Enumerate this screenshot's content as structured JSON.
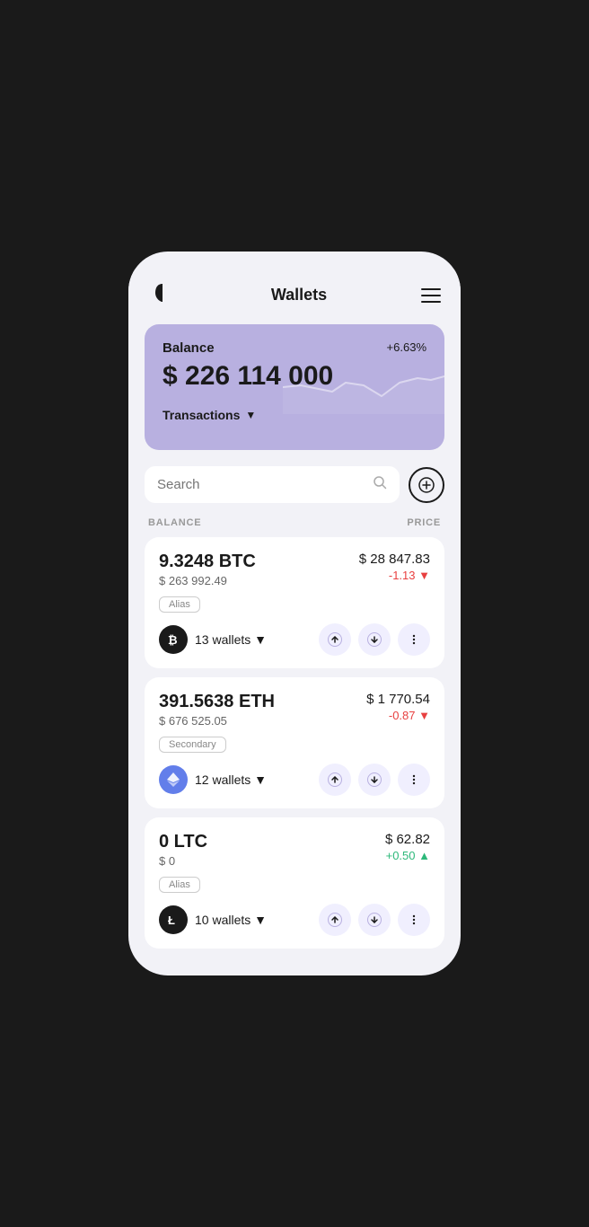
{
  "header": {
    "title": "Wallets",
    "menu_label": "menu"
  },
  "balance_card": {
    "label": "Balance",
    "percentage": "+6.63%",
    "amount": "$ 226 114 000",
    "transactions_label": "Transactions"
  },
  "search": {
    "placeholder": "Search"
  },
  "columns": {
    "balance": "BALANCE",
    "price": "PRICE"
  },
  "coins": [
    {
      "amount": "9.3248 BTC",
      "usd": "$ 263 992.49",
      "price": "$ 28 847.83",
      "change": "-1.13",
      "change_type": "neg",
      "alias": "Alias",
      "wallets": "13 wallets",
      "logo_type": "btc"
    },
    {
      "amount": "391.5638 ETH",
      "usd": "$ 676 525.05",
      "price": "$ 1 770.54",
      "change": "-0.87",
      "change_type": "neg",
      "alias": "Secondary",
      "wallets": "12 wallets",
      "logo_type": "eth"
    },
    {
      "amount": "0 LTC",
      "usd": "$ 0",
      "price": "$ 62.82",
      "change": "+0.50",
      "change_type": "pos",
      "alias": "Alias",
      "wallets": "10 wallets",
      "logo_type": "ltc"
    }
  ]
}
